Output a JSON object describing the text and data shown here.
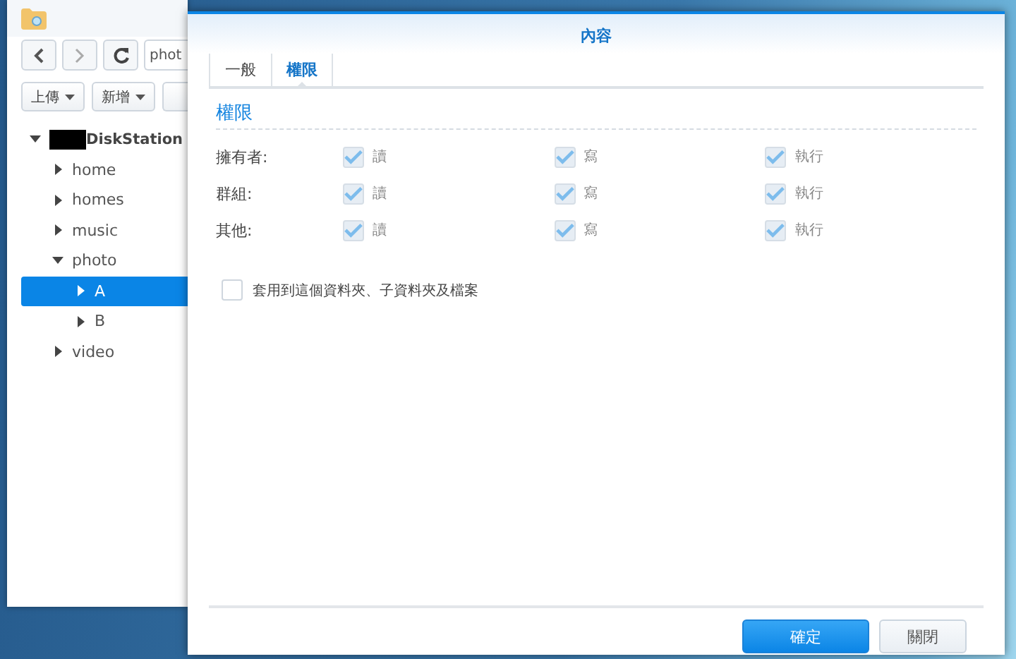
{
  "file_window": {
    "path": "phot",
    "toolbar": [
      {
        "label": "上傳"
      },
      {
        "label": "新增"
      }
    ],
    "tree": {
      "label": "DiskStation",
      "redacted": true,
      "expanded": true,
      "selected": false,
      "children": [
        {
          "label": "home",
          "expanded": false,
          "selected": false
        },
        {
          "label": "homes",
          "expanded": false,
          "selected": false
        },
        {
          "label": "music",
          "expanded": false,
          "selected": false
        },
        {
          "label": "photo",
          "expanded": true,
          "selected": false,
          "children": [
            {
              "label": "A",
              "expanded": false,
              "selected": true
            },
            {
              "label": "B",
              "expanded": false,
              "selected": false
            }
          ]
        },
        {
          "label": "video",
          "expanded": false,
          "selected": false
        }
      ]
    }
  },
  "dialog": {
    "title": "內容",
    "tabs": [
      {
        "label": "一般",
        "selected": false
      },
      {
        "label": "權限",
        "selected": true
      }
    ],
    "section": "權限",
    "permissions": [
      {
        "label": "擁有者:",
        "perms": [
          {
            "label": "讀",
            "checked": true,
            "disabled": true
          },
          {
            "label": "寫",
            "checked": true,
            "disabled": true
          },
          {
            "label": "執行",
            "checked": true,
            "disabled": true
          }
        ]
      },
      {
        "label": "群組:",
        "perms": [
          {
            "label": "讀",
            "checked": true,
            "disabled": true
          },
          {
            "label": "寫",
            "checked": true,
            "disabled": true
          },
          {
            "label": "執行",
            "checked": true,
            "disabled": true
          }
        ]
      },
      {
        "label": "其他:",
        "perms": [
          {
            "label": "讀",
            "checked": true,
            "disabled": true
          },
          {
            "label": "寫",
            "checked": true,
            "disabled": true
          },
          {
            "label": "執行",
            "checked": true,
            "disabled": true
          }
        ]
      }
    ],
    "apply": {
      "label": "套用到這個資料夾、子資料夾及檔案",
      "checked": false
    },
    "buttons": [
      {
        "label": "確定",
        "kind": "primary"
      },
      {
        "label": "關閉",
        "kind": "default"
      }
    ]
  }
}
